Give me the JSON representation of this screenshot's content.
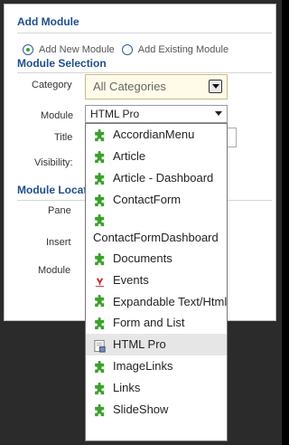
{
  "panel": {
    "title": "Add Module",
    "radio_new": "Add New Module",
    "radio_existing": "Add Existing Module",
    "section_selection": "Module Selection",
    "section_location": "Module Locat"
  },
  "form": {
    "category_label": "Category",
    "category_value": "All Categories",
    "module_label": "Module",
    "module_value": "HTML Pro",
    "title_label": "Title",
    "visibility_label": "Visibility:",
    "pane_label": "Pane",
    "insert_label": "Insert",
    "module2_label": "Module"
  },
  "dropdown": {
    "items": [
      {
        "label": "AccordianMenu",
        "icon": "puzzle-icon"
      },
      {
        "label": "Article",
        "icon": "puzzle-icon"
      },
      {
        "label": "Article - Dashboard",
        "icon": "puzzle-icon"
      },
      {
        "label": "ContactForm",
        "icon": "puzzle-icon"
      },
      {
        "label": "ContactFormDashboard",
        "icon": "puzzle-icon"
      },
      {
        "label": "Documents",
        "icon": "puzzle-icon"
      },
      {
        "label": "Events",
        "icon": "events-icon"
      },
      {
        "label": "Expandable Text/Html",
        "icon": "puzzle-icon"
      },
      {
        "label": "Form and List",
        "icon": "puzzle-icon"
      },
      {
        "label": "HTML Pro",
        "icon": "html-pro-icon"
      },
      {
        "label": "ImageLinks",
        "icon": "puzzle-icon"
      },
      {
        "label": "Links",
        "icon": "puzzle-icon"
      },
      {
        "label": "SlideShow",
        "icon": "puzzle-icon"
      }
    ],
    "selected_index": 9
  },
  "colors": {
    "heading": "#1f4e8a",
    "puzzle": "#3aa22a",
    "selected_bg": "#e6e6e6",
    "category_bg": "#fffbe8"
  }
}
